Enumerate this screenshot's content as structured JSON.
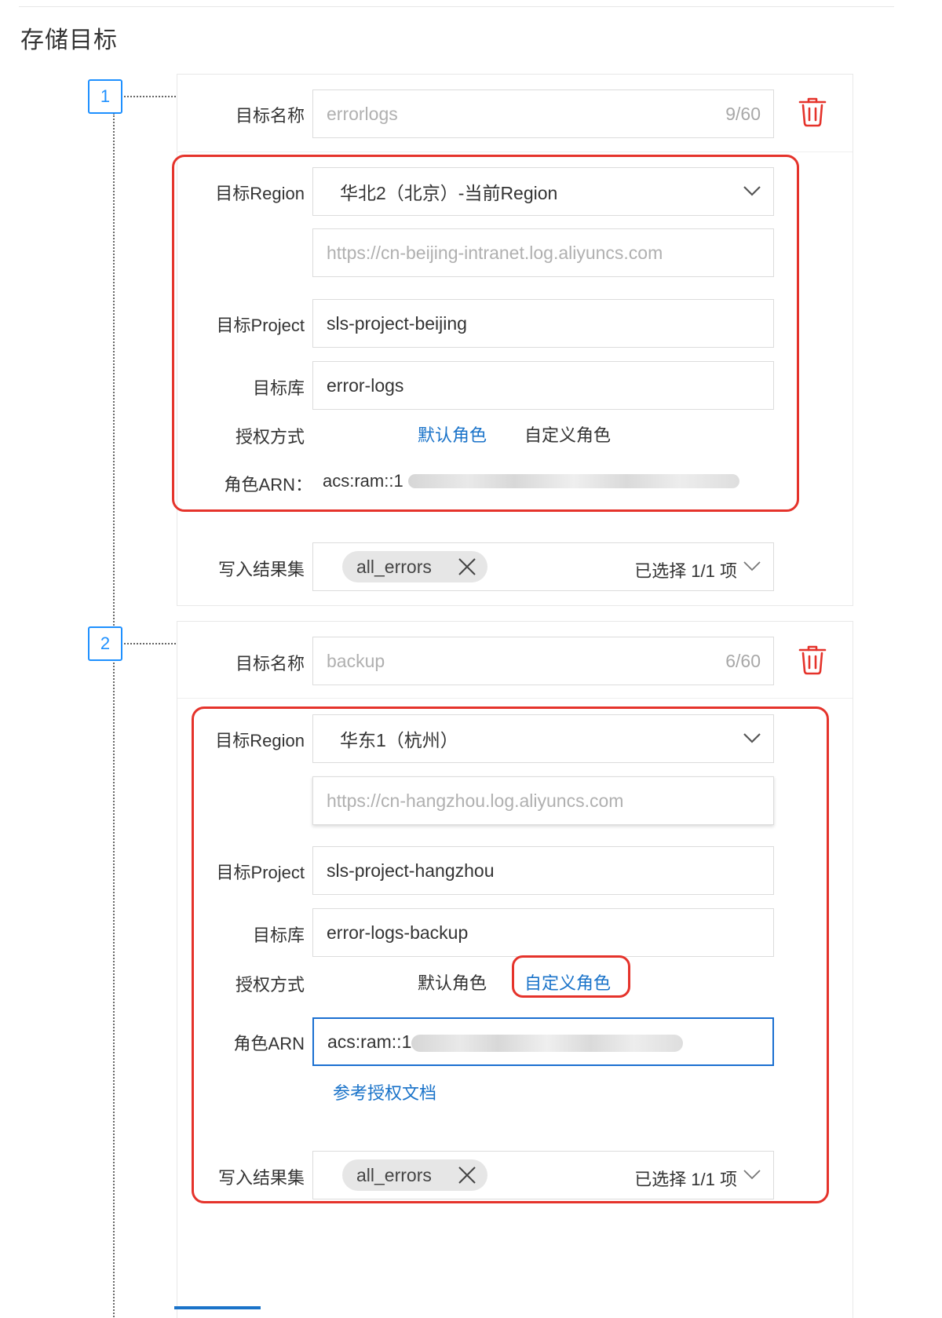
{
  "section_title": "存储目标",
  "colors": {
    "accent": "#1a73c9",
    "highlight": "#e5332b",
    "step": "#1e90ff",
    "trash": "#e5332b"
  },
  "targets": [
    {
      "index": "1",
      "name_label": "目标名称",
      "name_value": "errorlogs",
      "name_counter": "9/60",
      "region_label": "目标Region",
      "region_value": "华北2（北京）-当前Region",
      "endpoint_value": "https://cn-beijing-intranet.log.aliyuncs.com",
      "project_label": "目标Project",
      "project_value": "sls-project-beijing",
      "store_label": "目标库",
      "store_value": "error-logs",
      "auth_label": "授权方式",
      "auth_default": "默认角色",
      "auth_custom": "自定义角色",
      "auth_selected": "默认角色",
      "arn_label": "角色ARN：",
      "arn_value": "acs:ram::1",
      "result_label": "写入结果集",
      "result_tag": "all_errors",
      "result_summary": "已选择 1/1 项"
    },
    {
      "index": "2",
      "name_label": "目标名称",
      "name_value": "backup",
      "name_counter": "6/60",
      "region_label": "目标Region",
      "region_value": "华东1（杭州）",
      "endpoint_value": "https://cn-hangzhou.log.aliyuncs.com",
      "project_label": "目标Project",
      "project_value": "sls-project-hangzhou",
      "store_label": "目标库",
      "store_value": "error-logs-backup",
      "auth_label": "授权方式",
      "auth_default": "默认角色",
      "auth_custom": "自定义角色",
      "auth_selected": "自定义角色",
      "arn_label": "角色ARN",
      "arn_value": "acs:ram::1",
      "doc_link": "参考授权文档",
      "result_label": "写入结果集",
      "result_tag": "all_errors",
      "result_summary": "已选择 1/1 项"
    }
  ]
}
